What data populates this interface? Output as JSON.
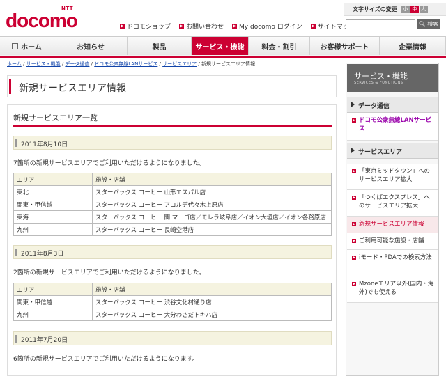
{
  "header": {
    "logo_ntt": "NTT",
    "logo_name": "docomo",
    "links": [
      {
        "label": "ドコモショップ"
      },
      {
        "label": "お問い合わせ"
      },
      {
        "label": "My docomo ログイン"
      },
      {
        "label": "サイトマップ"
      }
    ],
    "font_size_label": "文字サイズの変更",
    "font_sizes": [
      "小",
      "中",
      "大"
    ],
    "search_button": "検索"
  },
  "nav": {
    "home": "ホーム",
    "items": [
      "お知らせ",
      "製品",
      "サービス・機能",
      "料金・割引",
      "お客様サポート",
      "企業情報"
    ]
  },
  "breadcrumb": {
    "links": [
      "ホーム",
      "サービス・機能",
      "データ通信",
      "ドコモ公衆無線LANサービス",
      "サービスエリア"
    ],
    "separator": " / ",
    "current": "新規サービスエリア情報"
  },
  "page_title": "新規サービスエリア情報",
  "panel_title": "新規サービスエリア一覧",
  "sections": [
    {
      "date": "2011年8月10日",
      "note": "7箇所の新規サービスエリアでご利用いただけるようになりました。",
      "header": [
        "エリア",
        "施設・店舗"
      ],
      "rows": [
        [
          "東北",
          "スターバックス コーヒー 山形エスパル店"
        ],
        [
          "関東・甲信越",
          "スターバックス コーヒー アコルデ代々木上原店"
        ],
        [
          "東海",
          "スターバックス コーヒー 関 マーゴ店／モレラ岐阜店／イオン大垣店／イオン各務原店"
        ],
        [
          "九州",
          "スターバックス コーヒー 長崎空港店"
        ]
      ]
    },
    {
      "date": "2011年8月3日",
      "note": "2箇所の新規サービスエリアでご利用いただけるようになりました。",
      "header": [
        "エリア",
        "施設・店舗"
      ],
      "rows": [
        [
          "関東・甲信越",
          "スターバックス コーヒー 渋谷文化村通り店"
        ],
        [
          "九州",
          "スターバックス コーヒー 大分わさだトキハ店"
        ]
      ]
    },
    {
      "date": "2011年7月20日",
      "note": "6箇所の新規サービスエリアでご利用いただけるようになります。"
    }
  ],
  "sidebar": {
    "title": "サービス・機能",
    "subtitle": "SERVICES & FUNCTIONS",
    "sec1": "データ通信",
    "link_wlan": "ドコモ公衆無線LANサービス",
    "sec2": "サービスエリア",
    "items": [
      "「東京ミッドタウン」へのサービスエリア拡大",
      "「つくばエクスプレス」へのサービスエリア拡大",
      "新規サービスエリア情報",
      "ご利用可能な施設・店舗",
      "iモード・PDAでの検索方法",
      "Mzoneエリア以外(国内・海外)でも使える"
    ]
  },
  "colors": {
    "brand_red": "#cc0033",
    "magenta_link": "#9900aa",
    "date_bg": "#f5f3e0",
    "sidebar_head": "#666666"
  }
}
